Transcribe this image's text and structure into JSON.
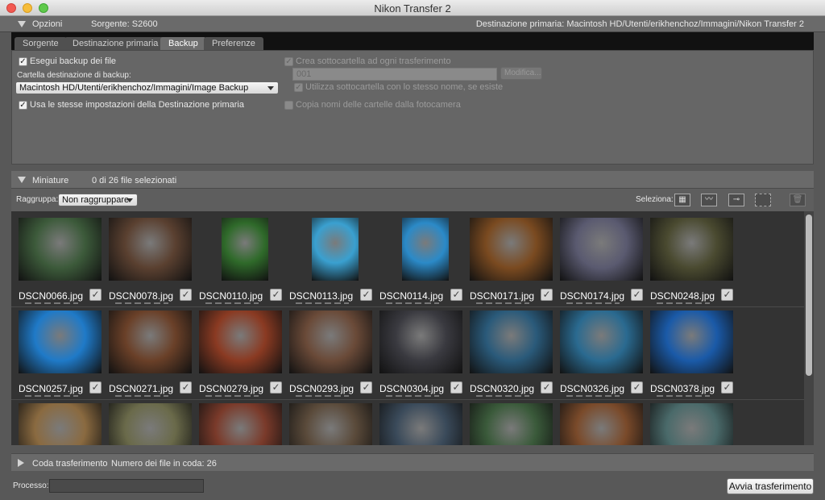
{
  "window": {
    "title": "Nikon Transfer 2"
  },
  "options": {
    "label": "Opzioni",
    "source": "Sorgente: S2600",
    "primary_destination": "Destinazione primaria:  Macintosh HD/Utenti/erikhenchoz/Immagini/Nikon Transfer 2"
  },
  "tabs": [
    {
      "label": "Sorgente",
      "active": false
    },
    {
      "label": "Destinazione primaria",
      "active": false
    },
    {
      "label": "Backup",
      "active": true
    },
    {
      "label": "Preferenze",
      "active": false
    }
  ],
  "backup": {
    "do_backup_label": "Esegui backup dei file",
    "do_backup_checked": true,
    "folder_label": "Cartella destinazione di backup:",
    "folder_value": "Macintosh HD/Utenti/erikhenchoz/Immagini/Image Backup",
    "same_settings_label": "Usa le stesse impostazioni della Destinazione primaria",
    "same_settings_checked": true,
    "create_subfolder_label": "Crea sottocartella ad ogni trasferimento",
    "subfolder_value": "001",
    "modify_label": "Modifica...",
    "use_existing_label": "Utilizza sottocartella con lo stesso nome, se esiste",
    "copy_names_label": "Copia nomi delle cartelle dalla fotocamera"
  },
  "thumbnails": {
    "label": "Miniature",
    "selection_count": "0 di 26 file selezionati",
    "group_label": "Raggruppa:",
    "group_value": "Non raggruppare",
    "select_label": "Seleziona:",
    "files": [
      {
        "name": "DSCN0066.jpg",
        "color": "#3c5a3a",
        "portrait": false
      },
      {
        "name": "DSCN0078.jpg",
        "color": "#5a4030",
        "portrait": false
      },
      {
        "name": "DSCN0110.jpg",
        "color": "#2f6a2a",
        "portrait": true
      },
      {
        "name": "DSCN0113.jpg",
        "color": "#3aa0d0",
        "portrait": true
      },
      {
        "name": "DSCN0114.jpg",
        "color": "#2b8ac8",
        "portrait": true
      },
      {
        "name": "DSCN0171.jpg",
        "color": "#7a4a20",
        "portrait": false
      },
      {
        "name": "DSCN0174.jpg",
        "color": "#5a5a70",
        "portrait": false
      },
      {
        "name": "DSCN0248.jpg",
        "color": "#4a4a30",
        "portrait": false
      },
      {
        "name": "DSCN0257.jpg",
        "color": "#1f7ac8",
        "portrait": false
      },
      {
        "name": "DSCN0271.jpg",
        "color": "#6a4028",
        "portrait": false
      },
      {
        "name": "DSCN0279.jpg",
        "color": "#8a3a22",
        "portrait": false
      },
      {
        "name": "DSCN0293.jpg",
        "color": "#6a4a38",
        "portrait": false
      },
      {
        "name": "DSCN0304.jpg",
        "color": "#3a3a40",
        "portrait": false
      },
      {
        "name": "DSCN0320.jpg",
        "color": "#2a5a7a",
        "portrait": false
      },
      {
        "name": "DSCN0326.jpg",
        "color": "#2a6a90",
        "portrait": false
      },
      {
        "name": "DSCN0378.jpg",
        "color": "#1a5aa8",
        "portrait": false
      },
      {
        "name": "",
        "color": "#8a6a40",
        "portrait": false
      },
      {
        "name": "",
        "color": "#6a6a4a",
        "portrait": false
      },
      {
        "name": "",
        "color": "#7a3a2a",
        "portrait": false
      },
      {
        "name": "",
        "color": "#5a4a3a",
        "portrait": false
      },
      {
        "name": "",
        "color": "#3a4a5a",
        "portrait": false
      },
      {
        "name": "",
        "color": "#3a5a3a",
        "portrait": false
      },
      {
        "name": "",
        "color": "#7a4a2a",
        "portrait": false
      },
      {
        "name": "",
        "color": "#4a6a6a",
        "portrait": false
      }
    ]
  },
  "queue": {
    "label": "Coda trasferimento",
    "count": "Numero dei file in coda: 26"
  },
  "footer": {
    "process_label": "Processo:",
    "start_label": "Avvia trasferimento"
  }
}
